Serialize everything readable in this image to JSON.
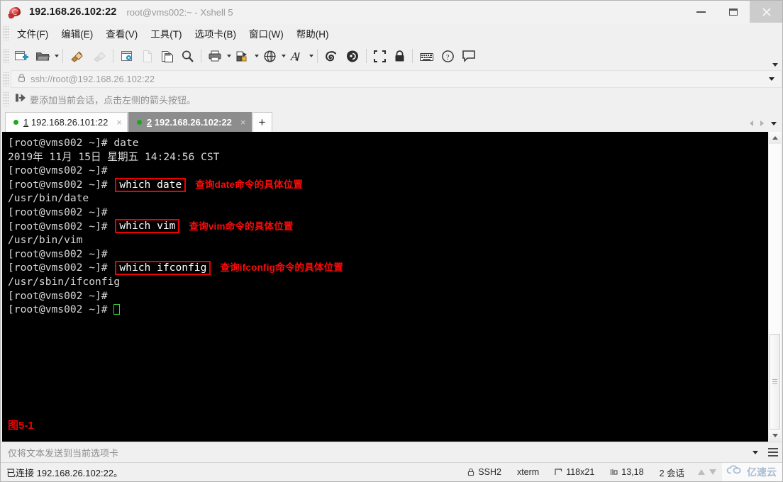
{
  "window": {
    "title": "192.168.26.102:22",
    "subtitle": "root@vms002:~ - Xshell 5",
    "app_icon": "xshell-icon",
    "controls": {
      "minimize": "minimize",
      "maximize": "maximize",
      "close": "close"
    }
  },
  "menu": [
    {
      "label": "文件(F)",
      "name": "menu-file"
    },
    {
      "label": "编辑(E)",
      "name": "menu-edit"
    },
    {
      "label": "查看(V)",
      "name": "menu-view"
    },
    {
      "label": "工具(T)",
      "name": "menu-tools"
    },
    {
      "label": "选项卡(B)",
      "name": "menu-tab"
    },
    {
      "label": "窗口(W)",
      "name": "menu-window"
    },
    {
      "label": "帮助(H)",
      "name": "menu-help"
    }
  ],
  "toolbar": {
    "items": [
      "new-session-icon",
      "open-folder-icon",
      "connect-icon",
      "disconnect-icon",
      "session-properties-icon",
      "new-file-icon",
      "copy-icon",
      "find-icon",
      "print-icon",
      "file-transfer-icon",
      "globe-icon",
      "font-icon",
      "xftp-icon",
      "xagent-icon",
      "fullscreen-icon",
      "lock-icon",
      "keyboard-icon",
      "help-icon",
      "comment-icon"
    ],
    "overflow": "toolbar-overflow-chevron"
  },
  "address": {
    "value": "ssh://root@192.168.26.102:22",
    "lock_icon": "lock-icon",
    "dropdown_icon": "chevron-down-icon"
  },
  "hint": {
    "icon": "add-session-arrow-icon",
    "text": "要添加当前会话，点击左侧的箭头按钮。"
  },
  "tabs": {
    "items": [
      {
        "num": "1",
        "label": "192.168.26.101:22",
        "active": false,
        "status": "connected"
      },
      {
        "num": "2",
        "label": "192.168.26.102:22",
        "active": true,
        "status": "connected"
      }
    ],
    "new_tab_label": "+",
    "close_glyph": "×",
    "scroll_left": "tab-scroll-left-icon",
    "scroll_right": "tab-scroll-right-icon",
    "list_dropdown": "tab-list-dropdown-icon"
  },
  "terminal": {
    "lines": [
      {
        "prompt": "[root@vms002 ~]# ",
        "text": "date"
      },
      {
        "prompt": "",
        "text": "2019年 11月 15日 星期五 14:24:56 CST"
      },
      {
        "prompt": "[root@vms002 ~]# ",
        "text": ""
      },
      {
        "prompt": "[root@vms002 ~]# ",
        "boxed": "which date",
        "anno": "查询date命令的具体位置"
      },
      {
        "prompt": "",
        "text": "/usr/bin/date"
      },
      {
        "prompt": "[root@vms002 ~]# ",
        "text": ""
      },
      {
        "prompt": "[root@vms002 ~]# ",
        "boxed": "which vim",
        "anno": "查询vim命令的具体位置"
      },
      {
        "prompt": "",
        "text": "/usr/bin/vim"
      },
      {
        "prompt": "[root@vms002 ~]# ",
        "text": ""
      },
      {
        "prompt": "[root@vms002 ~]# ",
        "boxed": "which ifconfig",
        "anno": "查询ifconfig命令的具体位置"
      },
      {
        "prompt": "",
        "text": "/usr/sbin/ifconfig"
      },
      {
        "prompt": "[root@vms002 ~]# ",
        "text": ""
      },
      {
        "prompt": "[root@vms002 ~]# ",
        "cursor": true
      }
    ],
    "figure_caption": "图5-1",
    "colors": {
      "background": "#000000",
      "text": "#d8d8d8",
      "annotation": "#ff0a0a",
      "box_border": "#ee0000",
      "cursor": "#2fd32f"
    }
  },
  "sendbar": {
    "placeholder": "仅将文本发送到当前选项卡",
    "dropdown_icon": "chevron-down-icon",
    "menu_icon": "hamburger-menu-icon"
  },
  "statusbar": {
    "connection": "已连接 192.168.26.102:22。",
    "protocol": "SSH2",
    "protocol_icon": "lock-icon",
    "terminal_type": "xterm",
    "size": "118x21",
    "size_icon": "resize-icon",
    "cursor_pos": "13,18",
    "cursor_icon": "cursor-pos-icon",
    "sessions": "2 会话",
    "transfer_up_icon": "arrow-up-icon",
    "transfer_down_icon": "arrow-down-icon",
    "watermark": "亿速云",
    "watermark_icon": "cloud-logo-icon"
  }
}
